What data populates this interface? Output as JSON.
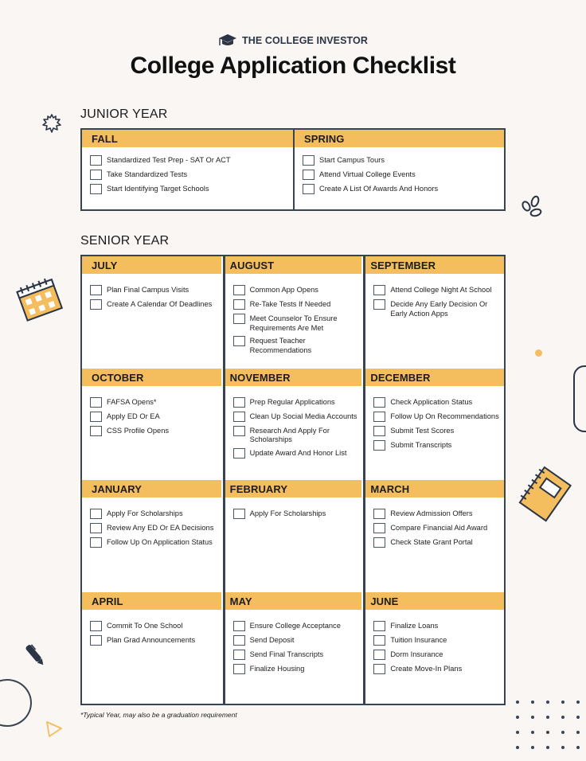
{
  "brand": {
    "name": "THE COLLEGE INVESTOR",
    "icon": "graduation-cap-icon"
  },
  "title": "College Application Checklist",
  "colors": {
    "accent": "#f4bd5d",
    "border": "#394452",
    "background": "#f9f6f3"
  },
  "junior_year": {
    "title": "JUNIOR YEAR",
    "cells": [
      {
        "label": "FALL",
        "items": [
          "Standardized Test Prep - SAT Or ACT",
          "Take Standardized Tests",
          "Start Identifying Target Schools"
        ]
      },
      {
        "label": "SPRING",
        "items": [
          "Start Campus Tours",
          "Attend Virtual College Events",
          "Create A List Of Awards And Honors"
        ]
      }
    ]
  },
  "senior_year": {
    "title": "SENIOR YEAR",
    "cells": [
      {
        "label": "JULY",
        "items": [
          "Plan Final Campus Visits",
          "Create A Calendar Of Deadlines"
        ]
      },
      {
        "label": "AUGUST",
        "items": [
          "Common App Opens",
          "Re-Take Tests If Needed",
          "Meet Counselor To Ensure Requirements Are Met",
          "Request Teacher Recommendations"
        ]
      },
      {
        "label": "SEPTEMBER",
        "items": [
          "Attend College Night At School",
          "Decide Any Early Decision Or Early Action Apps"
        ]
      },
      {
        "label": "OCTOBER",
        "items": [
          "FAFSA Opens*",
          "Apply ED Or EA",
          "CSS Profile Opens"
        ]
      },
      {
        "label": "NOVEMBER",
        "items": [
          "Prep Regular Applications",
          "Clean Up Social Media Accounts",
          "Research And Apply For Scholarships",
          "Update Award And Honor List"
        ]
      },
      {
        "label": "DECEMBER",
        "items": [
          "Check Application Status",
          "Follow Up On Recommendations",
          "Submit Test Scores",
          "Submit Transcripts"
        ]
      },
      {
        "label": "JANUARY",
        "items": [
          "Apply For Scholarships",
          "Review Any ED Or EA Decisions",
          "Follow Up On Application Status"
        ]
      },
      {
        "label": "FEBRUARY",
        "items": [
          "Apply For Scholarships"
        ]
      },
      {
        "label": "MARCH",
        "items": [
          "Review Admission Offers",
          "Compare Financial Aid Award",
          "Check State Grant Portal"
        ]
      },
      {
        "label": "APRIL",
        "items": [
          "Commit To One School",
          "Plan Grad Announcements"
        ]
      },
      {
        "label": "MAY",
        "items": [
          "Ensure College Acceptance",
          "Send Deposit",
          "Send Final Transcripts",
          "Finalize Housing"
        ]
      },
      {
        "label": "JUNE",
        "items": [
          "Finalize Loans",
          "Tuition Insurance",
          "Dorm Insurance",
          "Create Move-In Plans"
        ]
      }
    ]
  },
  "footnote": "*Typical Year, may also be a graduation requirement"
}
